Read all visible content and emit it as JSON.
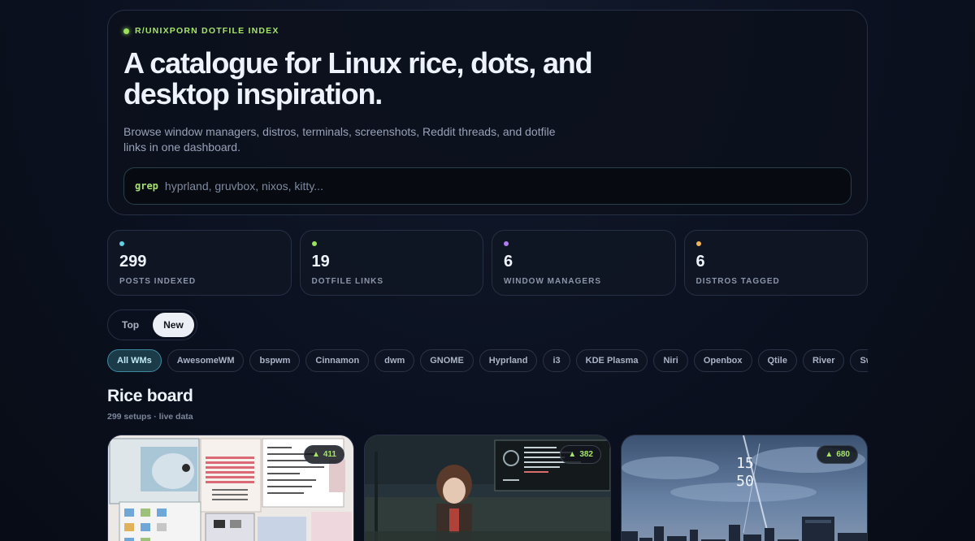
{
  "hero": {
    "eyebrow": "R/UNIXPORN DOTFILE INDEX",
    "title": "A catalogue for Linux rice, dots, and desktop inspiration.",
    "subtitle": "Browse window managers, distros, terminals, screenshots, Reddit threads, and dotfile links in one dashboard.",
    "search_prefix": "grep",
    "search_placeholder": "hyprland, gruvbox, nixos, kitty..."
  },
  "stats": [
    {
      "value": "299",
      "label": "POSTS INDEXED",
      "color": "#5fd0e6"
    },
    {
      "value": "19",
      "label": "DOTFILE LINKS",
      "color": "#9be15d"
    },
    {
      "value": "6",
      "label": "WINDOW MANAGERS",
      "color": "#b07cf0"
    },
    {
      "value": "6",
      "label": "DISTROS TAGGED",
      "color": "#f2b45a"
    }
  ],
  "sort": {
    "options": [
      "Top",
      "New"
    ],
    "selected": "New"
  },
  "filters": {
    "selected": "All WMs",
    "items": [
      "All WMs",
      "AwesomeWM",
      "bspwm",
      "Cinnamon",
      "dwm",
      "GNOME",
      "Hyprland",
      "i3",
      "KDE Plasma",
      "Niri",
      "Openbox",
      "Qtile",
      "River",
      "Sway"
    ]
  },
  "board": {
    "title": "Rice board",
    "meta": "299 setups · live data"
  },
  "cards": [
    {
      "score": "411",
      "arrow": "▲"
    },
    {
      "score": "382",
      "arrow": "▲"
    },
    {
      "score": "680",
      "arrow": "▲",
      "clock": "15\n50"
    }
  ]
}
